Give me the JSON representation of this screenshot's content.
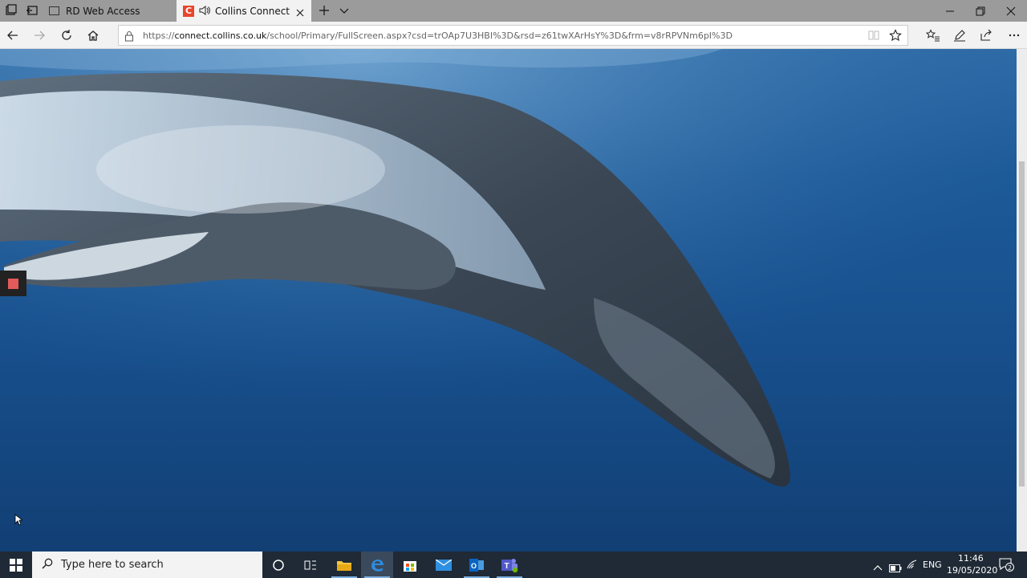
{
  "browser": {
    "tabs": [
      {
        "label": "RD Web Access",
        "active": false
      },
      {
        "label": "Collins Connect",
        "active": true,
        "audio": true
      }
    ],
    "url": {
      "prefix": "https://",
      "domain": "connect.collins.co.uk",
      "path": "/school/Primary/FullScreen.aspx?csd=trOAp7U3HBI%3D&rsd=z61twXArHsY%3D&frm=v8rRPVNm6pI%3D"
    }
  },
  "content": {
    "scene": "humpback whale underwater",
    "colors": {
      "water_top": "#2d6aa6",
      "water_bottom": "#123f74",
      "record": "#e25a5a"
    }
  },
  "taskbar": {
    "search_placeholder": "Type here to search",
    "language": "ENG",
    "time": "11:46",
    "date": "19/05/2020",
    "notification_count": "2"
  }
}
